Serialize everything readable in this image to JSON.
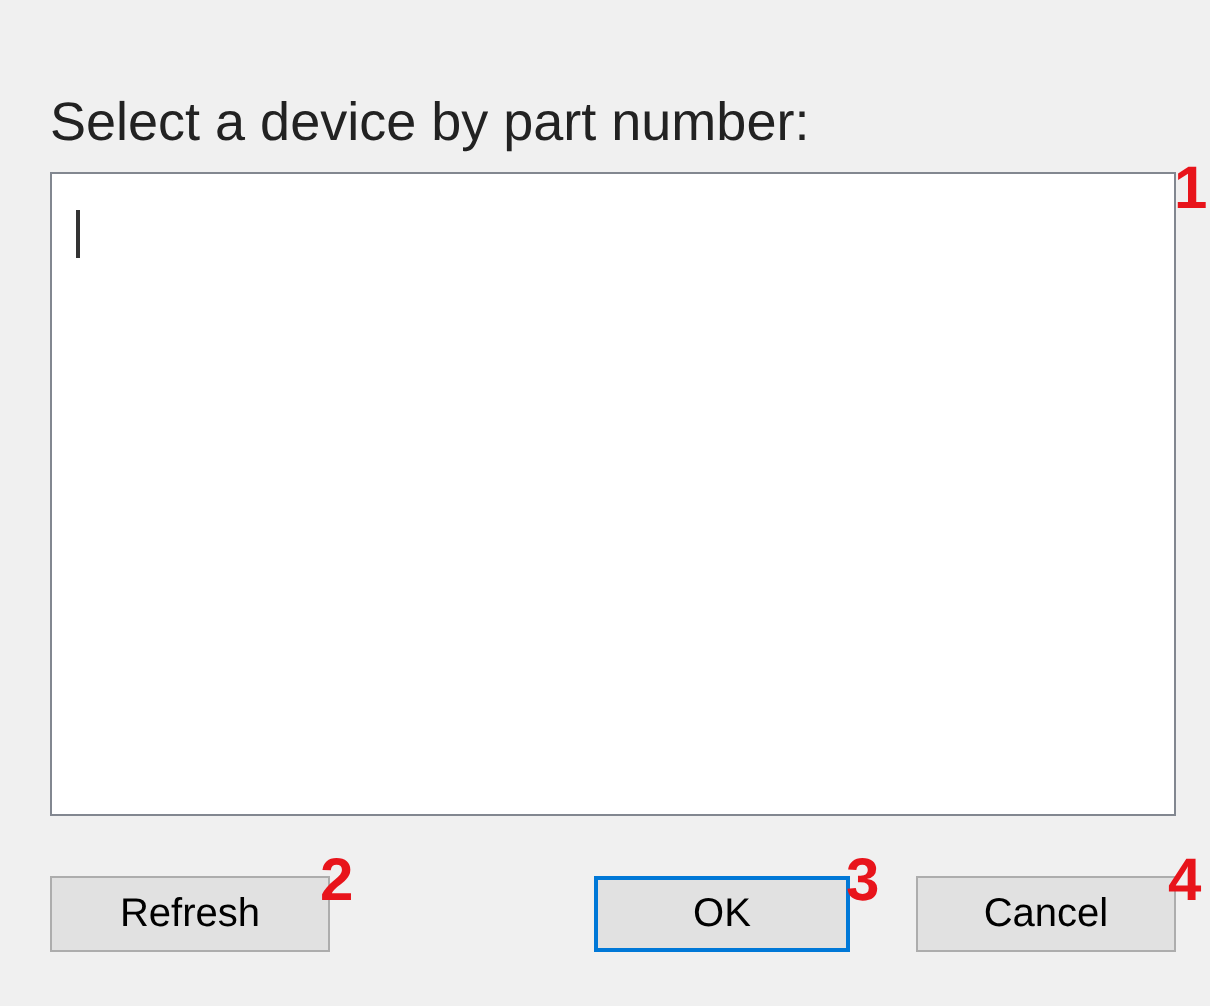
{
  "prompt": "Select a device by part number:",
  "buttons": [
    {
      "label": "Refresh",
      "kind": "normal"
    },
    {
      "label": "OK",
      "kind": "default"
    },
    {
      "label": "Cancel",
      "kind": "normal"
    }
  ],
  "annotations": [
    "1",
    "2",
    "3",
    "4"
  ]
}
